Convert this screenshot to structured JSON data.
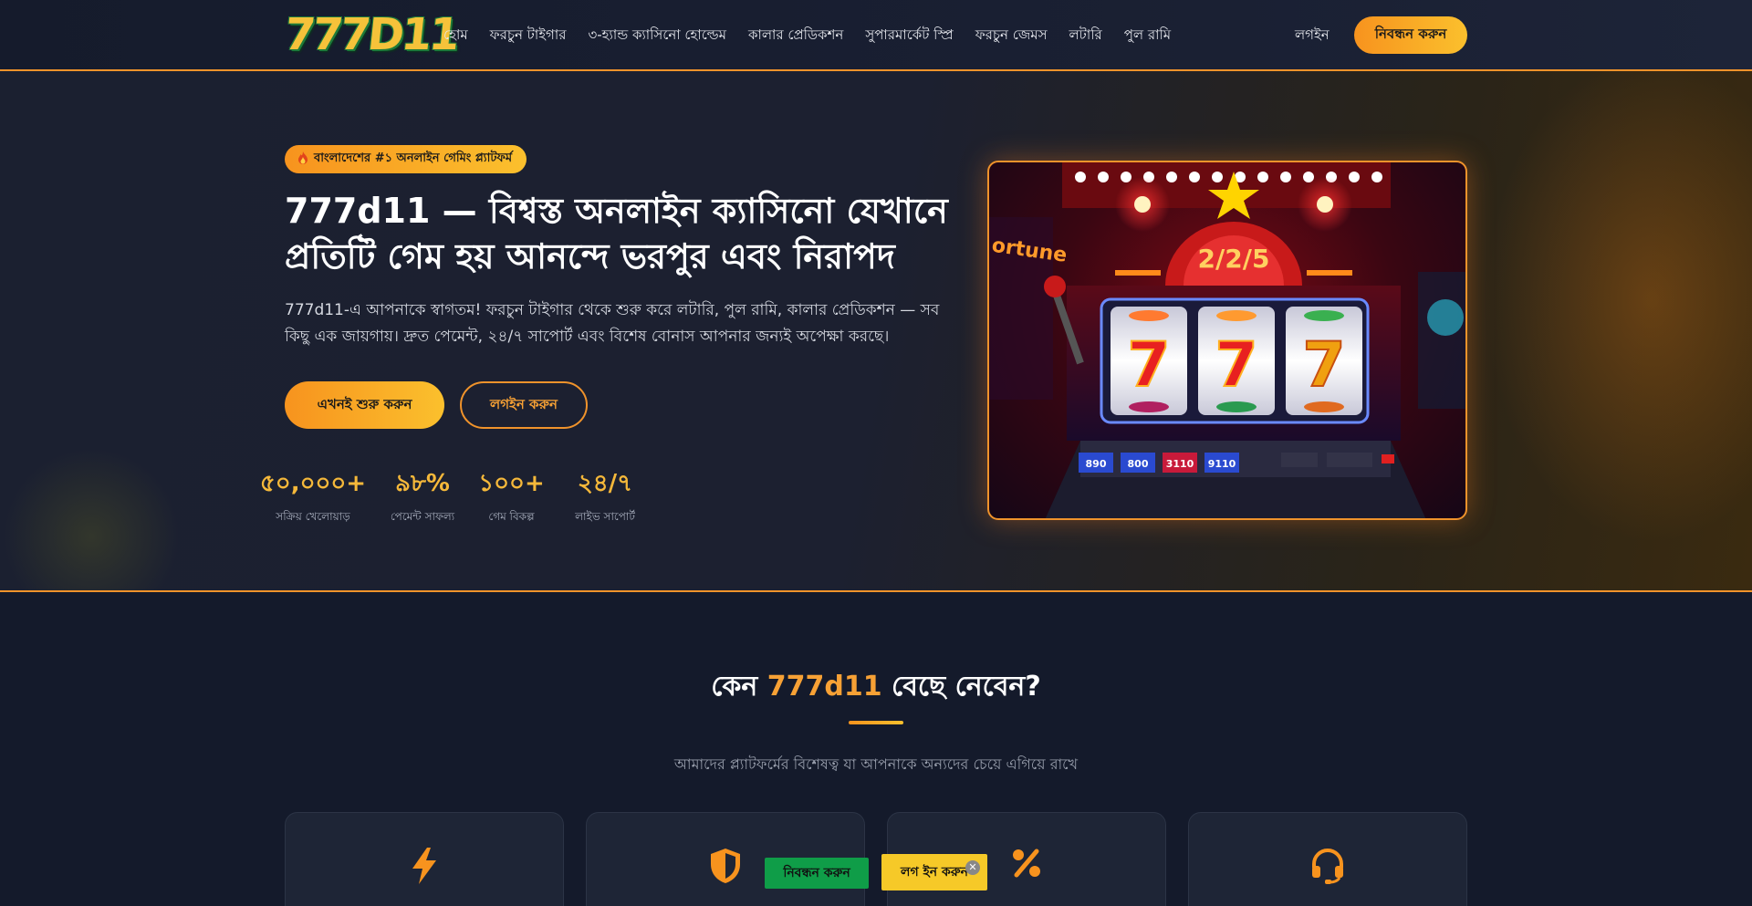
{
  "header": {
    "logo_text": "777D11",
    "nav": [
      "হোম",
      "ফরচুন টাইগার",
      "৩-হ্যান্ড ক্যাসিনো হোল্ডেম",
      "কালার প্রেডিকশন",
      "সুপারমার্কেট স্প্রি",
      "ফরচুন জেমস",
      "লটারি",
      "পুল রামি"
    ],
    "login_label": "লগইন",
    "register_label": "নিবন্ধন করুন"
  },
  "hero": {
    "badge_icon": "fire-icon",
    "badge_text": "বাংলাদেশের #১ অনলাইন গেমিং প্ল্যাটফর্ম",
    "title_line1": "777d11 — বিশ্বস্ত অনলাইন ক্যাসিনো যেখানে",
    "title_line2": "প্রতিটি গেম হয় আনন্দে ভরপুর এবং নিরাপদ",
    "description": "777d11-এ আপনাকে স্বাগতম! ফরচুন টাইগার থেকে শুরু করে লটারি, পুল রামি, কালার প্রেডিকশন — সব কিছু এক জায়গায়। দ্রুত পেমেন্ট, ২৪/৭ সাপোর্ট এবং বিশেষ বোনাস আপনার জন্যই অপেক্ষা করছে।",
    "start_button": "এখনই শুরু করুন",
    "login_button": "লগইন করুন",
    "stats": [
      {
        "value": "৫০,০০০+",
        "label": "সক্রিয় খেলোয়াড়"
      },
      {
        "value": "৯৮%",
        "label": "পেমেন্ট সাফল্য"
      },
      {
        "value": "১০০+",
        "label": "গেম বিকল্প"
      },
      {
        "value": "২৪/৭",
        "label": "লাইভ সাপোর্ট"
      }
    ],
    "image_reels": [
      "7",
      "7",
      "7"
    ]
  },
  "why": {
    "title_prefix": "কেন ",
    "title_accent": "777d11",
    "title_suffix": " বেছে নেবেন?",
    "subtitle": "আমাদের প্ল্যাটফর্মের বিশেষত্ব যা আপনাকে অন্যদের চেয়ে এগিয়ে রাখে",
    "card_icons": [
      "bolt-icon",
      "shield-icon",
      "percent-icon",
      "headset-icon"
    ]
  },
  "floating": {
    "register_label": "নিবন্ধন করুন",
    "login_label": "লগ ইন করুন",
    "close_glyph": "✕"
  },
  "colors": {
    "accent": "#f7931e",
    "accent_light": "#fbc02d",
    "background": "#141a2b"
  }
}
